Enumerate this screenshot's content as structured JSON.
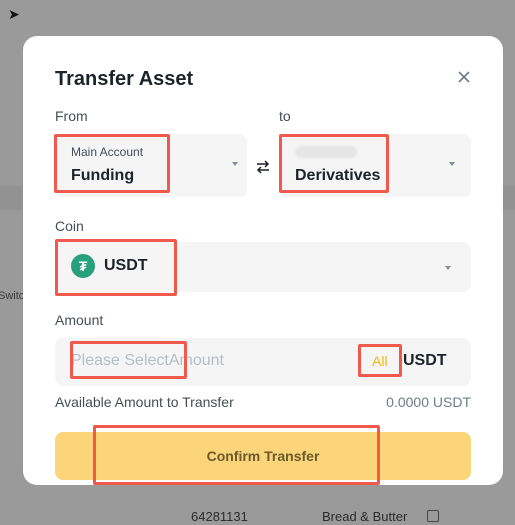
{
  "background": {
    "left_text": "Switc",
    "row": {
      "id": "64281131",
      "name": "Bread & Butter"
    }
  },
  "modal": {
    "title": "Transfer Asset",
    "from": {
      "label": "From",
      "account_caption": "Main Account",
      "account_value": "Funding"
    },
    "to": {
      "label": "to",
      "account_value": "Derivatives"
    },
    "coin": {
      "label": "Coin",
      "value": "USDT",
      "icon_glyph": "₮"
    },
    "amount": {
      "label": "Amount",
      "placeholder": "Please SelectAmount",
      "all_label": "All",
      "unit": "USDT"
    },
    "available": {
      "label": "Available Amount to Transfer",
      "value": "0.0000 USDT"
    },
    "confirm_label": "Confirm Transfer"
  },
  "colors": {
    "accent_yellow": "#f0b90b",
    "confirm_button": "#fcd57a",
    "highlight_box": "#ef5a4d",
    "tether_green": "#26a17b"
  }
}
